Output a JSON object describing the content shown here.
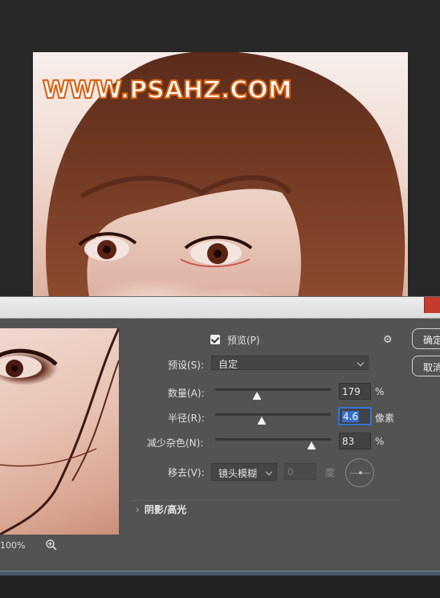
{
  "background_image": {
    "watermark": "WWW.PSAHZ.COM"
  },
  "dialog": {
    "preview_checkbox_label": "预览(P)",
    "preview_checked": true,
    "ok_button": "确定",
    "cancel_button": "取消",
    "preset_label": "预设(S):",
    "preset_value": "自定",
    "amount_label": "数量(A):",
    "amount_value": "179",
    "amount_unit": "%",
    "radius_label": "半径(R):",
    "radius_value": "4.6",
    "radius_unit": "像素",
    "noise_label": "减少杂色(N):",
    "noise_value": "83",
    "noise_unit": "%",
    "remove_label": "移去(V):",
    "remove_value": "镜头模糊",
    "angle_value": "0",
    "angle_unit": "度",
    "shadows_section": "阴影/高光",
    "zoom_level": "100%"
  },
  "slider_levels": {
    "amount_fraction": 0.36,
    "radius_fraction": 0.4,
    "noise_fraction": 0.83
  },
  "icons": {
    "gear": "gear-icon",
    "zoom": "zoom-in-icon",
    "chevron": "chevron-down-icon",
    "expand": "chevron-right-icon",
    "angle_dial": "angle-dial-icon"
  },
  "colors": {
    "watermark_stroke": "#d8600f",
    "dialog_bg": "#535353",
    "focus_blue": "#3a6fc8"
  }
}
